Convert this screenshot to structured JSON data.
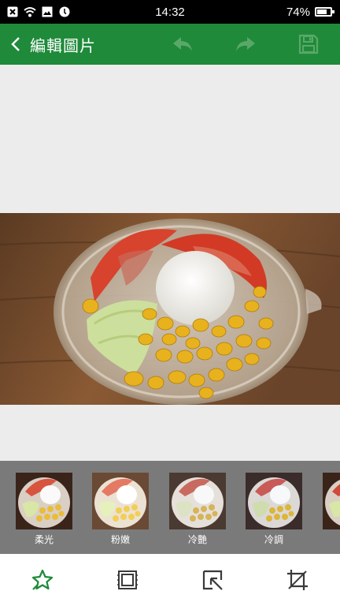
{
  "status_bar": {
    "time": "14:32",
    "battery": "74%",
    "battery_level": 0.74,
    "icons": [
      "notification-x-icon",
      "wifi-icon",
      "image-icon",
      "alarm-icon"
    ]
  },
  "app_bar": {
    "title": "編輯圖片",
    "actions": [
      "undo-icon",
      "redo-icon",
      "save-icon"
    ]
  },
  "filters": [
    {
      "label": "柔光"
    },
    {
      "label": "粉嫩"
    },
    {
      "label": "冷艷"
    },
    {
      "label": "冷調"
    }
  ],
  "tools": [
    "effects-star-icon",
    "frame-icon",
    "selection-icon",
    "crop-icon"
  ],
  "colors": {
    "app_bar": "#1e8a3a",
    "accent": "#1e8a3a",
    "filter_bar": "#7a7a7a",
    "tool_icon": "#3a3a3a"
  }
}
